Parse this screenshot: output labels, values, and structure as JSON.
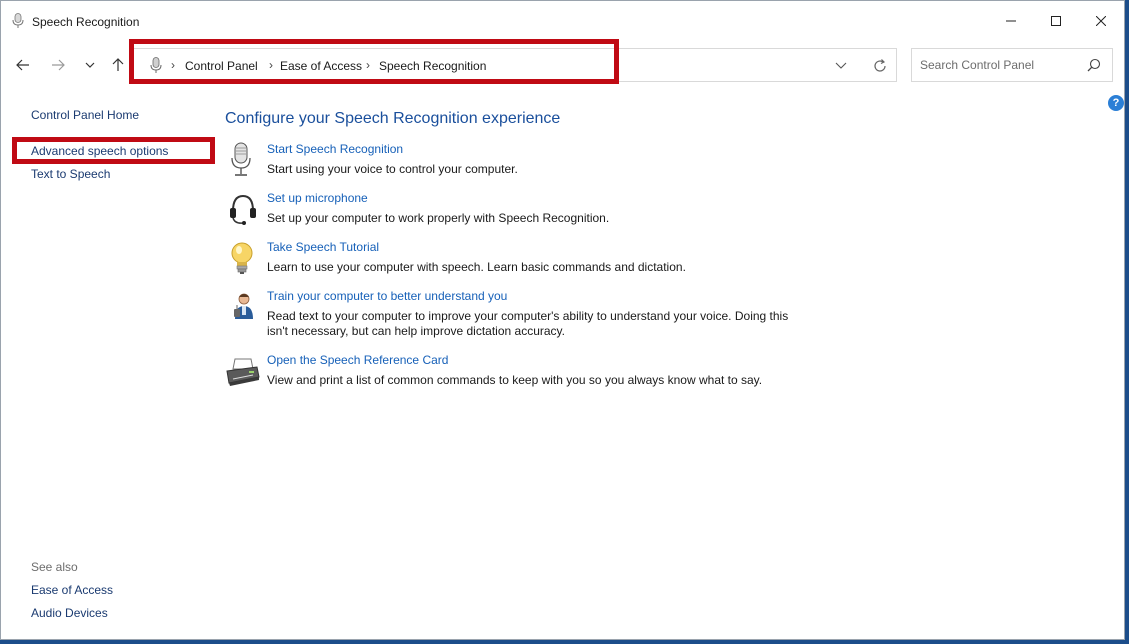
{
  "window": {
    "title": "Speech Recognition"
  },
  "address": {
    "crumbs": [
      "Control Panel",
      "Ease of Access",
      "Speech Recognition"
    ]
  },
  "search": {
    "placeholder": "Search Control Panel",
    "value": ""
  },
  "sidebar": {
    "home": "Control Panel Home",
    "items": [
      {
        "label": "Advanced speech options"
      },
      {
        "label": "Text to Speech"
      }
    ],
    "see_also_label": "See also",
    "see_also": [
      {
        "label": "Ease of Access"
      },
      {
        "label": "Audio Devices"
      }
    ]
  },
  "main": {
    "heading": "Configure your Speech Recognition experience",
    "tasks": [
      {
        "icon": "microphone-icon",
        "link": "Start Speech Recognition",
        "desc": "Start using your voice to control your computer."
      },
      {
        "icon": "headset-icon",
        "link": "Set up microphone",
        "desc": "Set up your computer to work properly with Speech Recognition."
      },
      {
        "icon": "lightbulb-icon",
        "link": "Take Speech Tutorial",
        "desc": "Learn to use your computer with speech.  Learn basic commands and dictation."
      },
      {
        "icon": "user-train-icon",
        "link": "Train your computer to better understand you",
        "desc": "Read text to your computer to improve your computer's ability to understand your voice.  Doing this isn't necessary, but can help improve dictation accuracy."
      },
      {
        "icon": "printer-icon",
        "link": "Open the Speech Reference Card",
        "desc": "View and print a list of common commands to keep with you so you always know what to say."
      }
    ]
  },
  "colors": {
    "highlight": "#c00a14",
    "link": "#1660b8",
    "heading": "#1a4f9c"
  }
}
